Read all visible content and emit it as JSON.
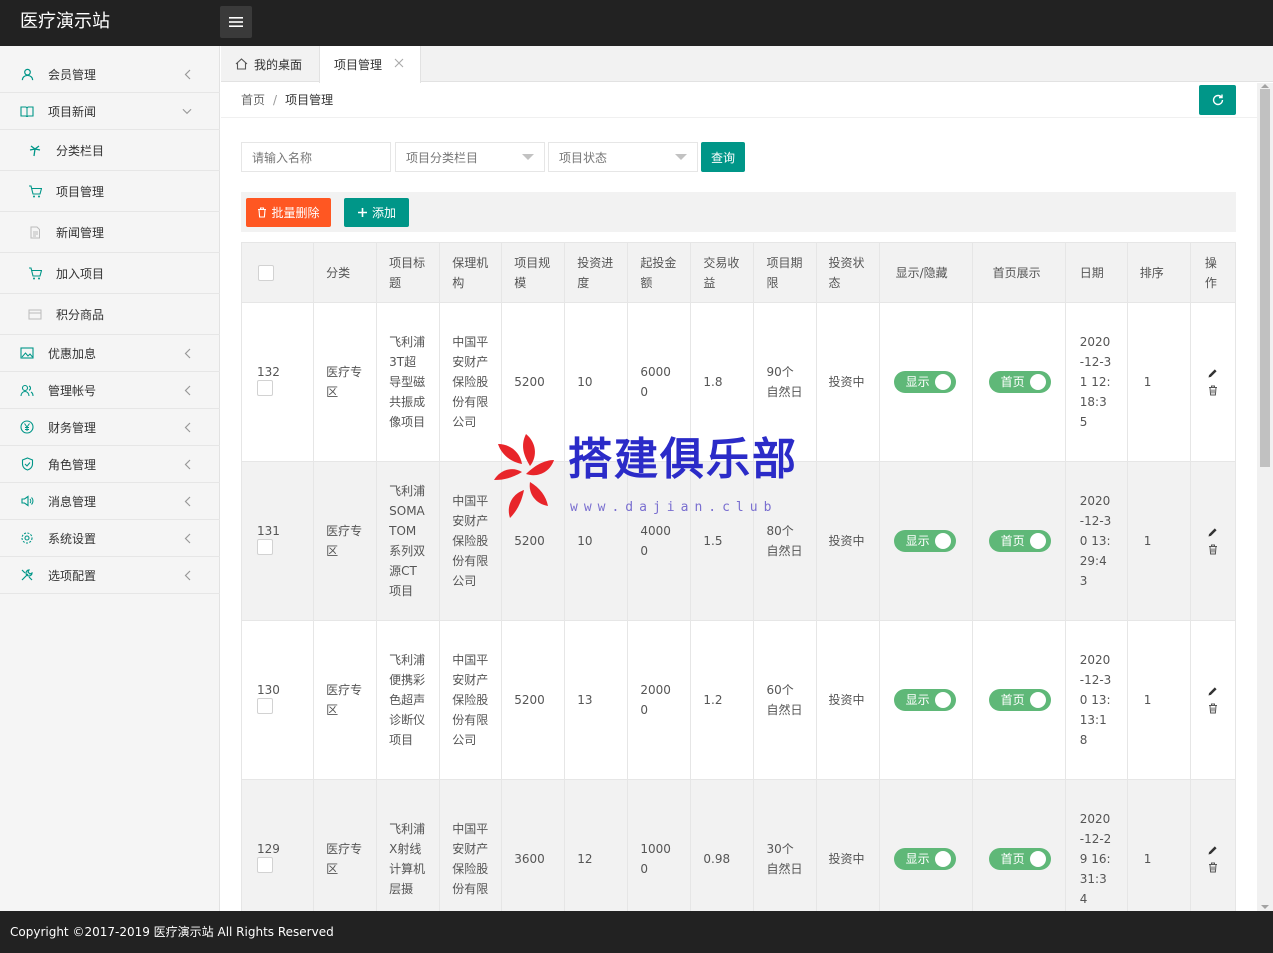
{
  "header": {
    "title": "医疗演示站"
  },
  "sidebar": {
    "items": [
      {
        "label": "会员管理",
        "icon": "user-icon"
      },
      {
        "label": "项目新闻",
        "icon": "book-icon",
        "expanded": true
      },
      {
        "label": "分类栏目",
        "icon": "palm-icon",
        "sub": true
      },
      {
        "label": "项目管理",
        "icon": "cart-icon",
        "sub": true
      },
      {
        "label": "新闻管理",
        "icon": "doc-icon",
        "sub": true
      },
      {
        "label": "加入项目",
        "icon": "cart-icon",
        "sub": true
      },
      {
        "label": "积分商品",
        "icon": "card-icon",
        "sub": true
      },
      {
        "label": "优惠加息",
        "icon": "image-icon"
      },
      {
        "label": "管理帐号",
        "icon": "users-icon"
      },
      {
        "label": "财务管理",
        "icon": "yen-icon"
      },
      {
        "label": "角色管理",
        "icon": "shield-icon"
      },
      {
        "label": "消息管理",
        "icon": "speaker-icon"
      },
      {
        "label": "系统设置",
        "icon": "gear-icon"
      },
      {
        "label": "选项配置",
        "icon": "tools-icon"
      }
    ]
  },
  "tabs": {
    "home": "我的桌面",
    "active": "项目管理"
  },
  "breadcrumb": {
    "home": "首页",
    "sep": "/",
    "current": "项目管理"
  },
  "filters": {
    "name_placeholder": "请输入名称",
    "category_select": "项目分类栏目",
    "status_select": "项目状态",
    "query": "查询"
  },
  "toolbar": {
    "batch_delete": "批量删除",
    "add": "添加"
  },
  "table": {
    "headers": [
      "分类",
      "项目标题",
      "保理机构",
      "项目规模",
      "投资进度",
      "起投金额",
      "交易收益",
      "项目期限",
      "投资状态",
      "显示/隐藏",
      "首页展示",
      "日期",
      "排序",
      "操作"
    ],
    "rows": [
      {
        "id": "132",
        "category": "医疗专区",
        "title": "飞利浦3T超导型磁共振成像项目",
        "agency": "中国平安财产保险股份有限公司",
        "scale": "5200",
        "progress": "10",
        "min_invest": "60000",
        "yield": "1.8",
        "term": "90个自然日",
        "status": "投资中",
        "show": "显示",
        "home": "首页",
        "date": "2020-12-31 12:18:35",
        "sort": "1"
      },
      {
        "id": "131",
        "category": "医疗专区",
        "title": "飞利浦SOMATOM系列双源CT项目",
        "agency": "中国平安财产保险股份有限公司",
        "scale": "5200",
        "progress": "10",
        "min_invest": "40000",
        "yield": "1.5",
        "term": "80个自然日",
        "status": "投资中",
        "show": "显示",
        "home": "首页",
        "date": "2020-12-30 13:29:43",
        "sort": "1"
      },
      {
        "id": "130",
        "category": "医疗专区",
        "title": "飞利浦便携彩色超声诊断仪项目",
        "agency": "中国平安财产保险股份有限公司",
        "scale": "5200",
        "progress": "13",
        "min_invest": "20000",
        "yield": "1.2",
        "term": "60个自然日",
        "status": "投资中",
        "show": "显示",
        "home": "首页",
        "date": "2020-12-30 13:13:18",
        "sort": "1"
      },
      {
        "id": "129",
        "category": "医疗专区",
        "title": "飞利浦X射线计算机层摄",
        "agency": "中国平安财产保险股份有限",
        "scale": "3600",
        "progress": "12",
        "min_invest": "10000",
        "yield": "0.98",
        "term": "30个自然日",
        "status": "投资中",
        "show": "显示",
        "home": "首页",
        "date": "2020-12-29 16:31:34",
        "sort": "1"
      }
    ]
  },
  "watermark": {
    "text": "搭建俱乐部",
    "url": "www.dajian.club"
  },
  "footer": {
    "text": "Copyright ©2017-2019 医疗演示站 All Rights Reserved"
  },
  "colors": {
    "primary": "#009688",
    "danger": "#ff5722",
    "switch_on": "#5fb878",
    "header_bg": "#222222"
  }
}
